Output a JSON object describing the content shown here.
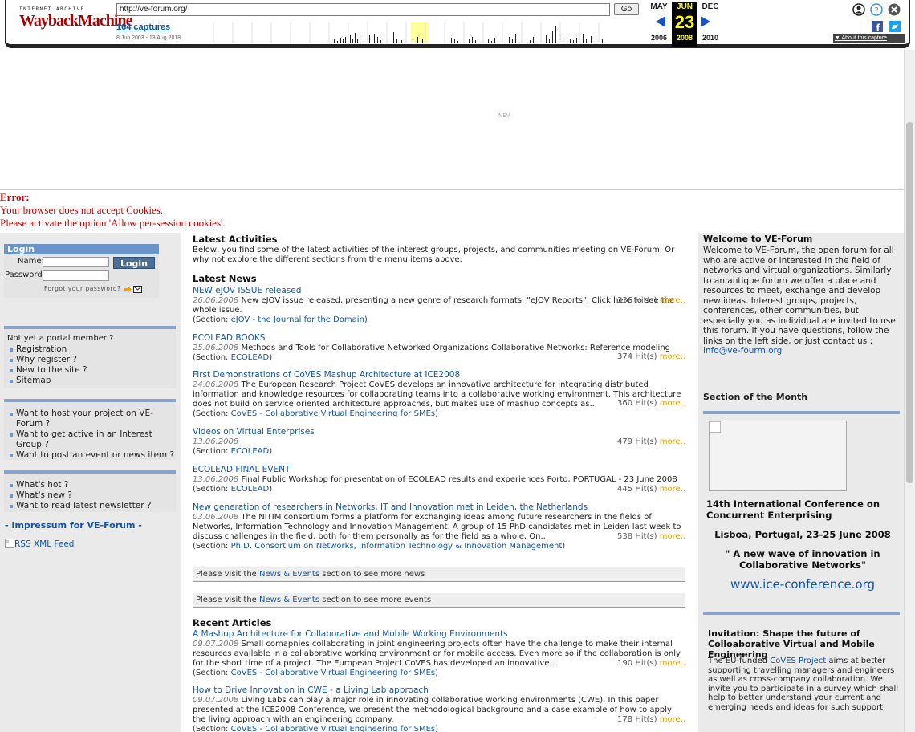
{
  "wayback": {
    "logo_top": "INTERNET ARCHIVE",
    "logo_main": "WaybackMachine",
    "url": "http://ve-forum.org/",
    "go_label": "Go",
    "captures": "164 captures",
    "range": "8 Jun 2003 - 13 Aug 2018",
    "prev_month": "MAY",
    "prev_year": "2006",
    "cur_month": "JUN",
    "cur_day": "23",
    "cur_year": "2008",
    "next_month": "DEC",
    "next_year": "2010",
    "about": "About this capture",
    "icons": [
      "account-icon",
      "help-icon",
      "close-icon",
      "facebook-icon",
      "twitter-icon"
    ]
  },
  "banner_nav": "NEV",
  "error": {
    "title": "Error:",
    "line1": "Your browser does not accept Cookies.",
    "line2": "Please activate the option 'Allow per-session cookies'."
  },
  "login": {
    "title": "Login",
    "name_label": "Name:",
    "password_label": "Password:",
    "button": "Login",
    "forgot": "Forgot your password?"
  },
  "member": {
    "question": "Not yet a portal member ?",
    "items": [
      "Registration",
      "Why register ?",
      "New to the site ?",
      "Sitemap"
    ]
  },
  "host": {
    "items": [
      "Want to host your project on VE-Forum ?",
      "Want to get active in an Interest Group ?",
      "Want to post an event or news item ?"
    ]
  },
  "whats": {
    "items": [
      "What's hot ?",
      "What's new ?",
      "Want to read latest newsletter ?"
    ]
  },
  "impressum": "- Impressum for VE-Forum -",
  "rss": "RSS XML Feed",
  "activities": {
    "title": "Latest Activities",
    "text": "Below, you find some of the latest activities of the interest groups, projects, and communities meeting on VE-Forum. Or why not explore the different sections from the menu items above."
  },
  "news": {
    "title": "Latest News",
    "items": [
      {
        "title": "NEW eJOV ISSUE released",
        "date": "26.06.2008",
        "text": "New eJOV issue released, presenting a new genre of research formats, \"eJOV Reports\". Click here to see the whole issue.",
        "hits": "336 Hit(s)",
        "more": "more..",
        "section_label": "(Section:",
        "section": "eJOV - the Journal for the Domain",
        "close": ")"
      },
      {
        "title": "ECOLEAD BOOKS",
        "date": "25.06.2008",
        "text": "Methods and Tools for Collaborative Networked Organizations Collaborative Networks: Reference modeling",
        "hits": "374 Hit(s)",
        "more": "more..",
        "section_label": "(Section:",
        "section": "ECOLEAD",
        "close": ")"
      },
      {
        "title": "First Demonstrations of CoVES Mashup Architecture at ICE2008",
        "date": "24.06.2008",
        "text": "The European Research Project CoVES develops an innovative architecture for integrating distributed information and knowledge resources for collaborating teams into a collaborative working environment. This architecture does not build on service oriented architecture approaches, but makes use of mashup concepts as..",
        "hits": "360 Hit(s)",
        "more": "more..",
        "section_label": "(Section:",
        "section": "CoVES - Collaborative Virtual Engineering for SMEs",
        "close": ")"
      },
      {
        "title": "Videos on Virtual Enterprises",
        "date": "13.06.2008",
        "text": "",
        "hits": "479 Hit(s)",
        "more": "more..",
        "section_label": "(Section:",
        "section": "ECOLEAD",
        "close": ")"
      },
      {
        "title": "ECOLEAD FINAL EVENT",
        "date": "13.06.2008",
        "text": "Final Public Workshop for presentation of ECOLEAD results and experiences Porto, PORTUGAL - 23 June 2008",
        "hits": "445 Hit(s)",
        "more": "more..",
        "section_label": "(Section:",
        "section": "ECOLEAD",
        "close": ")"
      },
      {
        "title": "New generation of researchers in Networks, IT and Innovation met in Leiden, the Netherlands",
        "date": "03.06.2008",
        "text": "The NITIM consortium forms a platform for exchanging ideas among future researchers in the fields of Networks, Information Technology and Innovation Management. A group of 15 PhD candidates met in Leiden last week to discuss challenges in the field, both for them personally as for the field as a whole. On..",
        "hits": "538 Hit(s)",
        "more": "more..",
        "section_label": "(Section:",
        "section": "Ph.D. Consortium on Networks, Information Technology & Innovation Management",
        "close": ")"
      }
    ]
  },
  "visit_news": {
    "pre": "Please visit the ",
    "link": "News & Events",
    "post": " section to see more news"
  },
  "visit_events": {
    "pre": "Please visit the ",
    "link": "News & Events",
    "post": " section to see more events"
  },
  "articles": {
    "title": "Recent Articles",
    "items": [
      {
        "title": "A Mashup Architecture for Collaborative and Mobile Working Environments",
        "date": "09.07.2008",
        "text": "Small comapnies collaborating in joint engineering projects often have the challenge to make their internal resources available in a collaborative working environment or for mobile access. Even more so if the collaboration is only for the short time of a project. The European Project CoVES has developed an innovative..",
        "hits": "190 Hit(s)",
        "more": "more..",
        "section_label": "(Section:",
        "section": "CoVES - Collaborative Virtual Engineering for SMEs",
        "close": ")"
      },
      {
        "title": "How to Drive Innovation in CWE - a Living Lab approach",
        "date": "09.07.2008",
        "text": "Living Labs can play a major role in innovating collaborative working environments (CWE). In this paper presented at the ICE2008 Conference, we present the methodological background and a case example of how to apply the living approach with an engineering company.",
        "hits": "178 Hit(s)",
        "more": "more..",
        "section_label": "(Section:",
        "section": "CoVES - Collaborative Virtual Engineering for SMEs",
        "close": ")"
      }
    ]
  },
  "welcome": {
    "title": "Welcome to VE-Forum",
    "text": "Welcome to VE-Forum, the open forum for all who are active or interested in the field of networks and virtual organizations. Similarly to an antique forum we offer a place and resources to meet, exchange and develop new ideas. Interest groups, projects, conferences, other communities, but especially you as individual are invited to use this forum. If you have questions, follow the links on the left side, or just contact us : ",
    "email": "info@ve-fourm.org"
  },
  "som": {
    "title": "Section of the Month",
    "conf_title": "14th International Conference on Concurrent Enterprising",
    "location": "Lisboa, Portugal, 23-25 June 2008",
    "quote": "\" A new wave of innovation in Collaborative Networks\"",
    "url": "www.ice-conference.org"
  },
  "invitation": {
    "title": "Invitation: Shape the future of Colloaborative Virtual and Mobile Engineering",
    "pre": "The EU-funded ",
    "link": "CoVES Project",
    "text": " aims at better supporting travelling managers and engineers as well as cross-company collaboration. We invite you to participate in a survey which shall help to better understand your current and emerging needs and ideas for such support."
  },
  "colors": {
    "accent": "#6a95c9",
    "link": "#1155aa",
    "error": "#cc0000",
    "more": "#e8a000"
  }
}
